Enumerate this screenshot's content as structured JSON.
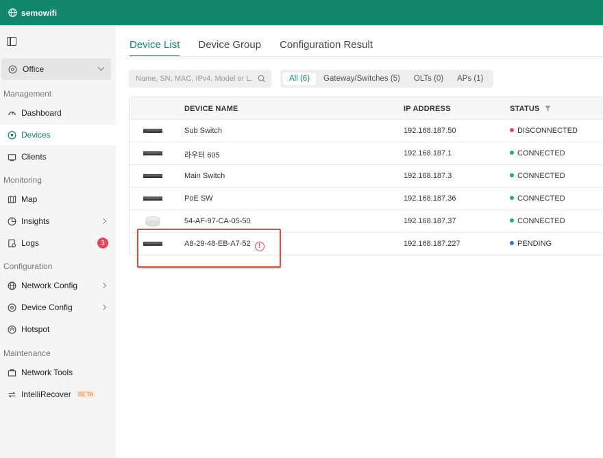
{
  "app": {
    "title": "semowifi"
  },
  "site": {
    "label": "Office"
  },
  "sidebar": {
    "sections": {
      "management": "Management",
      "monitoring": "Monitoring",
      "configuration": "Configuration",
      "maintenance": "Maintenance"
    },
    "items": {
      "dashboard": {
        "label": "Dashboard",
        "icon": "dashboard-icon"
      },
      "devices": {
        "label": "Devices",
        "icon": "devices-icon",
        "active": true
      },
      "clients": {
        "label": "Clients",
        "icon": "clients-icon"
      },
      "map": {
        "label": "Map",
        "icon": "map-icon"
      },
      "insights": {
        "label": "Insights",
        "icon": "insights-icon"
      },
      "logs": {
        "label": "Logs",
        "icon": "logs-icon",
        "badge": "3"
      },
      "network_config": {
        "label": "Network Config",
        "icon": "network-config-icon"
      },
      "device_config": {
        "label": "Device Config",
        "icon": "device-config-icon"
      },
      "hotspot": {
        "label": "Hotspot",
        "icon": "hotspot-icon"
      },
      "network_tools": {
        "label": "Network Tools",
        "icon": "network-tools-icon"
      },
      "intellirecover": {
        "label": "IntelliRecover",
        "icon": "intellirecover-icon",
        "tag": "BETA"
      }
    }
  },
  "tabs": {
    "device_list": "Device List",
    "device_group": "Device Group",
    "configuration_result": "Configuration Result"
  },
  "search": {
    "placeholder": "Name, SN, MAC, IPv4, Model or L..."
  },
  "filters": {
    "all": "All (6)",
    "gateway_switches": "Gateway/Switches (5)",
    "olts": "OLTs (0)",
    "aps": "APs (1)"
  },
  "table": {
    "columns": {
      "name": "DEVICE NAME",
      "ip": "IP ADDRESS",
      "status": "STATUS"
    },
    "rows": [
      {
        "name": "Sub Switch",
        "ip": "192.168.187.50",
        "status": "DISCONNECTED",
        "status_color": "#e8455a",
        "type": "switch"
      },
      {
        "name": "라우터 605",
        "ip": "192.168.187.1",
        "status": "CONNECTED",
        "status_color": "#1bb07c",
        "type": "switch"
      },
      {
        "name": "Main Switch",
        "ip": "192.168.187.3",
        "status": "CONNECTED",
        "status_color": "#1bb07c",
        "type": "switch"
      },
      {
        "name": "PoE SW",
        "ip": "192.168.187.36",
        "status": "CONNECTED",
        "status_color": "#1bb07c",
        "type": "switch"
      },
      {
        "name": "54-AF-97-CA-05-50",
        "ip": "192.168.187.37",
        "status": "CONNECTED",
        "status_color": "#1bb07c",
        "type": "ap"
      },
      {
        "name": "A8-29-48-EB-A7-52",
        "ip": "192.168.187.227",
        "status": "PENDING",
        "status_color": "#2f6fd6",
        "type": "switch",
        "warning": "!"
      }
    ]
  },
  "colors": {
    "brand": "#12876a",
    "badge": "#e8455a"
  }
}
